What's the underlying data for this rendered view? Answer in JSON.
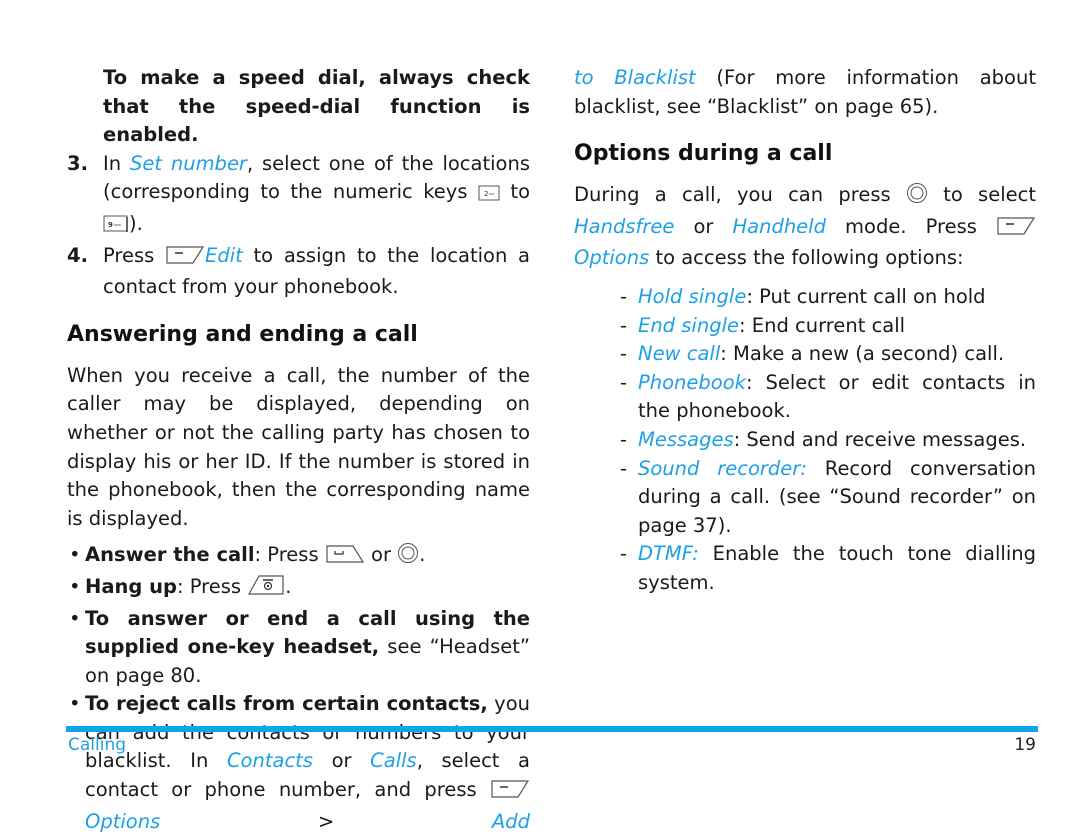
{
  "left_column": {
    "speed_dial_note": "To make a speed dial, always check that the speed-dial function is enabled.",
    "step3": {
      "num": "3.",
      "pre": "In ",
      "link": "Set number",
      "post": ", select one of the locations (corresponding to the numeric keys ",
      "key_from_icon": "key-2-icon",
      "mid": " to ",
      "key_to_icon": "key-9-icon",
      "end": ")."
    },
    "step4": {
      "num": "4.",
      "pre": "Press ",
      "softkey_icon": "left-softkey-icon",
      "link": "Edit",
      "post": " to assign to the location a contact from your phonebook."
    },
    "heading": "Answering and ending a call",
    "intro": "When you receive a call, the number of the caller may be displayed, depending on whether or not the calling party has chosen to display his or her ID. If the number is stored in the phonebook, then the corresponding name is displayed.",
    "bullets": [
      {
        "bold": "Answer the call",
        "text1": ": Press ",
        "icon1": "call-key-icon",
        "text2": " or ",
        "icon2": "navigation-center-key-icon",
        "text3": "."
      },
      {
        "bold": "Hang up",
        "text1": ": Press ",
        "icon1": "end-key-icon",
        "text2": "."
      },
      {
        "bold": "To answer or end a call using the supplied one-key headset,",
        "text1": " see “Headset” on page 80."
      },
      {
        "bold": "To reject calls from certain contacts,",
        "text1": " you can add the contacts or numbers to your blacklist. In ",
        "link1": "Contacts",
        "text2": " or ",
        "link2": "Calls",
        "text3": ", select a contact or phone number, and press ",
        "icon1": "left-softkey-icon",
        "link3": "Options",
        "text4": " > ",
        "link4": "Add"
      }
    ]
  },
  "right_column": {
    "continuation": {
      "link": "to Blacklist",
      "text": " (For more information about blacklist, see “Blacklist” on page 65)."
    },
    "heading": "Options during a call",
    "intro": {
      "t1": "During a call, you can press ",
      "icon1": "navigation-center-key-icon",
      "t2": " to select ",
      "link1": "Handsfree",
      "t3": " or ",
      "link2": "Handheld",
      "t4": " mode. Press ",
      "icon2": "left-softkey-icon",
      "link3": "Options",
      "t5": " to access the following options:"
    },
    "options": [
      {
        "name": "Hold single",
        "sep": ": ",
        "desc": "Put current call on hold"
      },
      {
        "name": "End single",
        "sep": ": ",
        "desc": "End current call"
      },
      {
        "name": "New call",
        "sep": ": ",
        "desc": "Make a new (a second) call."
      },
      {
        "name": "Phonebook",
        "sep": ": ",
        "desc": "Select or edit contacts in the phonebook."
      },
      {
        "name": "Messages",
        "sep": ": ",
        "desc": "Send and receive messages."
      },
      {
        "name": "Sound recorder:",
        "sep": " ",
        "desc": "Record conversation during a call. (see “Sound recorder” on page 37)."
      },
      {
        "name": "DTMF:",
        "sep": " ",
        "desc": "Enable the touch tone dialling system."
      }
    ]
  },
  "footer": {
    "section": "Calling",
    "page_number": "19"
  },
  "colors": {
    "link": "#1ea0e6",
    "footer_bar": "#0ea5ec",
    "text": "#1a1a1a"
  }
}
